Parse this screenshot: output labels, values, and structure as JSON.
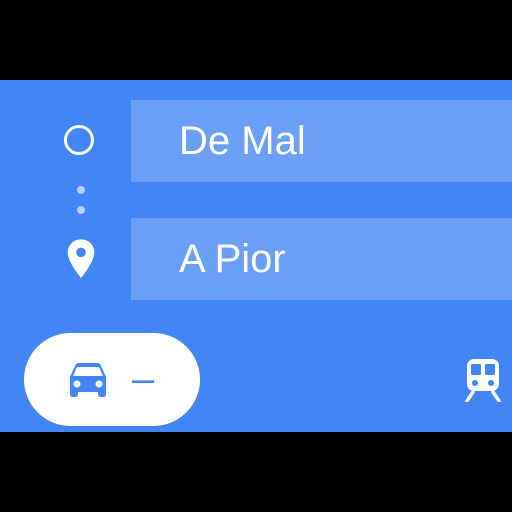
{
  "directions": {
    "origin": {
      "value": "De Mal",
      "icon": "origin-circle-icon"
    },
    "destination": {
      "value": "A Pior",
      "icon": "location-pin-icon"
    },
    "route_dots_icon": "route-dots-icon"
  },
  "travel_modes": [
    {
      "mode": "driving",
      "icon": "car-icon",
      "duration": "–",
      "selected": true
    },
    {
      "mode": "transit",
      "icon": "train-icon",
      "selected": false
    }
  ],
  "colors": {
    "primary": "#4285F4",
    "field": "#6A9EF7",
    "text": "#FFFFFF",
    "background": "#000000"
  }
}
